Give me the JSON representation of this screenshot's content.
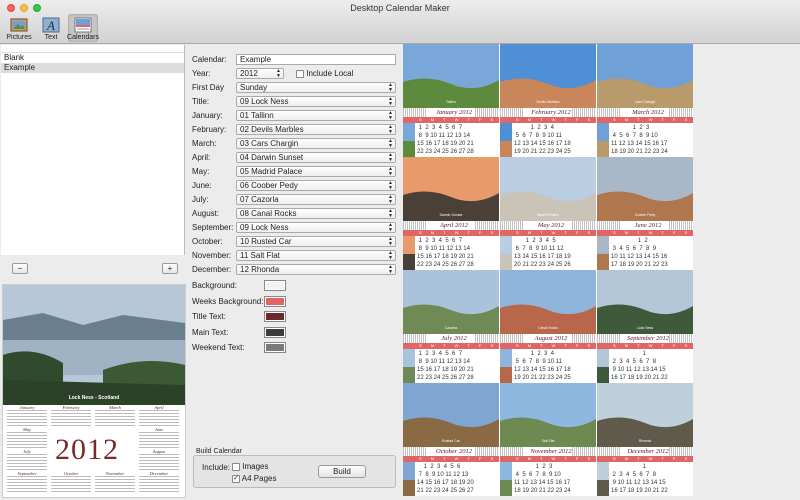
{
  "window": {
    "title": "Desktop Calendar Maker"
  },
  "toolbar": {
    "items": [
      {
        "label": "Pictures"
      },
      {
        "label": "Text"
      },
      {
        "label": "Calendars"
      }
    ]
  },
  "sidebar": {
    "items": [
      {
        "label": "Blank"
      },
      {
        "label": "Example"
      }
    ],
    "add_label": "+",
    "remove_label": "−"
  },
  "preview": {
    "caption": "Lock Ness - Scotland",
    "year": "2012",
    "months": [
      "January",
      "February",
      "March",
      "April",
      "May",
      "June",
      "July",
      "August",
      "September",
      "October",
      "November",
      "December"
    ]
  },
  "form": {
    "calendar": {
      "label": "Calendar:",
      "value": "Example"
    },
    "year": {
      "label": "Year:",
      "value": "2012"
    },
    "include_local": {
      "label": "Include Local"
    },
    "first_day": {
      "label": "First Day",
      "value": "Sunday"
    },
    "title": {
      "label": "Title:",
      "value": "09 Lock Ness"
    },
    "months": [
      {
        "label": "January:",
        "value": "01 Tallinn"
      },
      {
        "label": "February:",
        "value": "02 Devils Marbles"
      },
      {
        "label": "March:",
        "value": "03 Cars Chargin"
      },
      {
        "label": "April:",
        "value": "04 Darwin Sunset"
      },
      {
        "label": "May:",
        "value": "05 Madrid Palace"
      },
      {
        "label": "June:",
        "value": "06 Coober Pedy"
      },
      {
        "label": "July:",
        "value": "07 Cazorla"
      },
      {
        "label": "August:",
        "value": "08 Canal Rocks"
      },
      {
        "label": "September:",
        "value": "09 Lock Ness"
      },
      {
        "label": "October:",
        "value": "10 Rusted Car"
      },
      {
        "label": "November:",
        "value": "11 Salt Flat"
      },
      {
        "label": "December:",
        "value": "12 Rhonda"
      }
    ],
    "colors": [
      {
        "label": "Background:",
        "color": "#f2f2f2"
      },
      {
        "label": "Weeks Background:",
        "color": "#e06666"
      },
      {
        "label": "Title Text:",
        "color": "#6b2a2a"
      },
      {
        "label": "Main Text:",
        "color": "#3c3c3c"
      },
      {
        "label": "Weekend Text:",
        "color": "#7a7a7a"
      }
    ]
  },
  "build": {
    "group_label": "Build Calendar",
    "include_label": "Include:",
    "images_label": "Images",
    "a4_label": "A4 Pages",
    "button_label": "Build"
  },
  "calendar_grid": {
    "weekdays": "S M T W T F S",
    "months": [
      {
        "name": "January 2012",
        "caption": "Tallinn",
        "sky": "#7aa7d9",
        "ground": "#5d8a3c",
        "days": " 1  2  3  4  5  6  7\n 8  9 10 11 12 13 14\n15 16 17 18 19 20 21\n22 23 24 25 26 27 28"
      },
      {
        "name": "February 2012",
        "caption": "Devils Marbles",
        "sky": "#4f8fd6",
        "ground": "#c8865a",
        "days": "          1  2  3  4\n 5  6  7  8  9 10 11\n12 13 14 15 16 17 18\n19 20 21 22 23 24 25"
      },
      {
        "name": "March 2012",
        "caption": "Cars Chargin",
        "sky": "#6fa0d8",
        "ground": "#b99a6a",
        "days": "             1  2  3\n 4  5  6  7  8  9 10\n11 12 13 14 15 16 17\n18 19 20 21 22 23 24"
      },
      {
        "name": "April 2012",
        "caption": "Darwin Sunset",
        "sky": "#e89a6a",
        "ground": "#4a4038",
        "days": " 1  2  3  4  5  6  7\n 8  9 10 11 12 13 14\n15 16 17 18 19 20 21\n22 23 24 25 26 27 28"
      },
      {
        "name": "May 2012",
        "caption": "Madrid Palace",
        "sky": "#b9cde3",
        "ground": "#c9c3b8",
        "days": "       1  2  3  4  5\n 6  7  8  9 10 11 12\n13 14 15 16 17 18 19\n20 21 22 23 24 25 26"
      },
      {
        "name": "June 2012",
        "caption": "Coober Pedy",
        "sky": "#a9b8c9",
        "ground": "#b0774e",
        "days": "                1  2\n 3  4  5  6  7  8  9\n10 11 12 13 14 15 16\n17 18 19 20 21 22 23"
      },
      {
        "name": "July 2012",
        "caption": "Cazorla",
        "sky": "#aac3dc",
        "ground": "#6f8a55",
        "days": " 1  2  3  4  5  6  7\n 8  9 10 11 12 13 14\n15 16 17 18 19 20 21\n22 23 24 25 26 27 28"
      },
      {
        "name": "August 2012",
        "caption": "Canal Rocks",
        "sky": "#8fb5dc",
        "ground": "#b8674a",
        "days": "          1  2  3  4\n 5  6  7  8  9 10 11\n12 13 14 15 16 17 18\n19 20 21 22 23 24 25"
      },
      {
        "name": "September 2012",
        "caption": "Lock Ness",
        "sky": "#b3c6d8",
        "ground": "#3f5a3a",
        "days": "                   1\n 2  3  4  5  6  7  8\n 9 10 11 12 13 14 15\n16 17 18 19 20 21 22"
      },
      {
        "name": "October 2012",
        "caption": "Rusted Car",
        "sky": "#7fa6d3",
        "ground": "#8a6a44",
        "days": "    1  2  3  4  5  6\n 7  8  9 10 11 12 13\n14 15 16 17 18 19 20\n21 22 23 24 25 26 27"
      },
      {
        "name": "November 2012",
        "caption": "Salt Flat",
        "sky": "#8fb8e0",
        "ground": "#6d8a52",
        "days": "             1  2  3\n 4  5  6  7  8  9 10\n11 12 13 14 15 16 17\n18 19 20 21 22 23 24"
      },
      {
        "name": "December 2012",
        "caption": "Rhonda",
        "sky": "#c0cfdc",
        "ground": "#5f5a4a",
        "days": "                   1\n 2  3  4  5  6  7  8\n 9 10 11 12 13 14 15\n16 17 18 19 20 21 22"
      }
    ]
  }
}
